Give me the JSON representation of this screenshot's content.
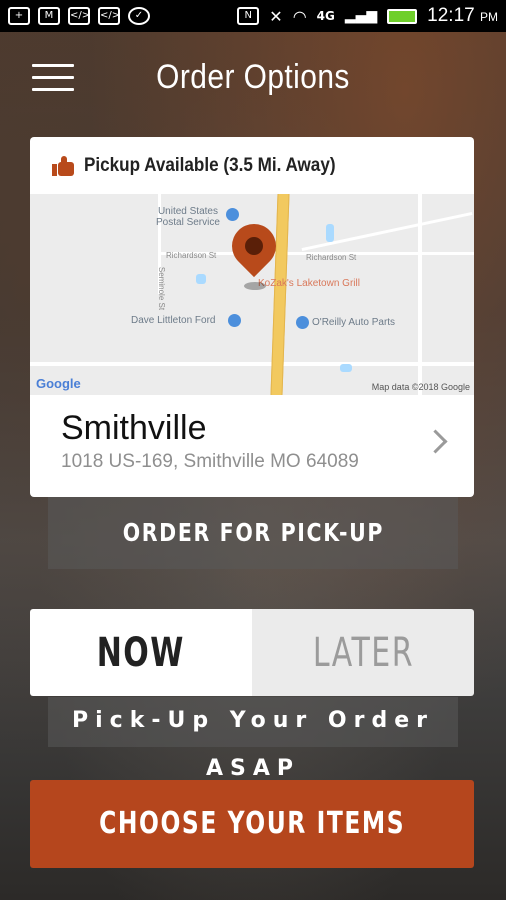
{
  "status_bar": {
    "time": "12:17",
    "ampm": "PM",
    "network": "4G",
    "icons": [
      "add-icon",
      "gmail-icon",
      "code-icon",
      "code-icon",
      "messenger-icon",
      "nfc-icon",
      "mute-icon",
      "wifi-icon",
      "signal-icon",
      "battery-icon"
    ]
  },
  "header": {
    "title": "Order Options",
    "menu_icon": "hamburger-menu-icon"
  },
  "location_card": {
    "pickup_status": "Pickup Available (3.5 Mi. Away)",
    "status_icon": "thumbs-up-icon",
    "map": {
      "labels": {
        "post_office": "United States\nPostal Service",
        "street1": "Richardson St",
        "street2": "Richardson St",
        "street3": "Seminole St",
        "restaurant": "KoZak's Laketown Grill",
        "dealer": "Dave Littleton Ford",
        "auto_parts": "O'Reilly Auto Parts"
      },
      "google": "Google",
      "attribution": "Map data ©2018 Google"
    },
    "name": "Smithville",
    "address": "1018 US-169, Smithville MO 64089",
    "chevron_icon": "chevron-right-icon"
  },
  "order_type_label": "ORDER FOR PICK-UP",
  "time_toggle": {
    "now": "NOW",
    "later": "LATER",
    "selected": "NOW"
  },
  "time_caption": "Pick-Up Your Order ASAP",
  "cta": "CHOOSE YOUR ITEMS",
  "colors": {
    "accent": "#b5461d",
    "road": "#f2c95f"
  }
}
